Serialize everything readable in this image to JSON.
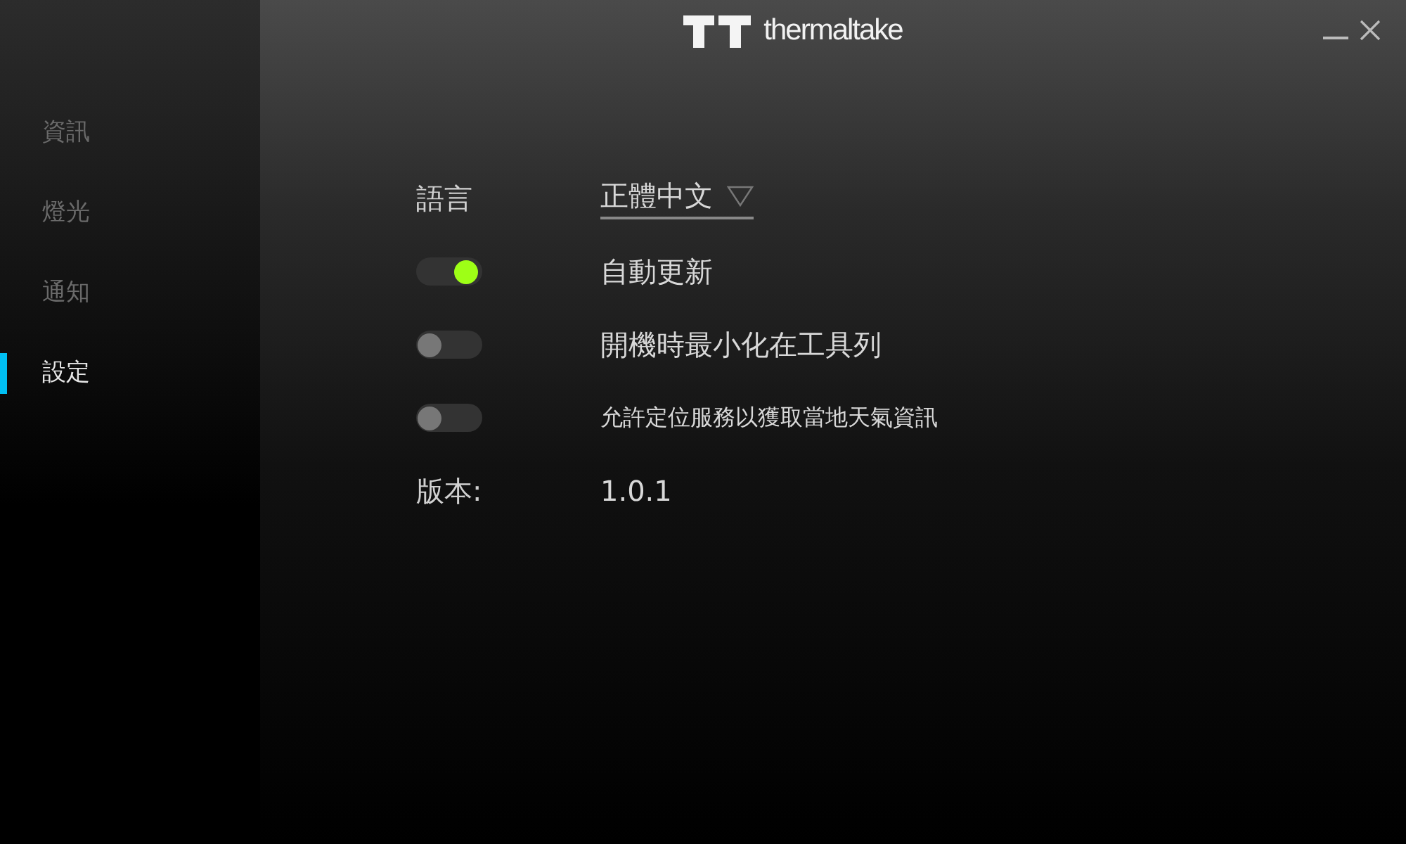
{
  "header": {
    "brand": "thermaltake"
  },
  "sidebar": {
    "items": [
      {
        "label": "資訊",
        "selected": false
      },
      {
        "label": "燈光",
        "selected": false
      },
      {
        "label": "通知",
        "selected": false
      },
      {
        "label": "設定",
        "selected": true
      }
    ]
  },
  "settings": {
    "rows": [
      {
        "kind": "dropdown",
        "label": "語言",
        "value": "正體中文"
      },
      {
        "kind": "toggle",
        "label": "自動更新",
        "on": true
      },
      {
        "kind": "toggle",
        "label": "開機時最小化在工具列",
        "on": false
      },
      {
        "kind": "toggle",
        "label": "允許定位服務以獲取當地天氣資訊",
        "on": false,
        "small": true
      },
      {
        "kind": "info",
        "label": "版本:",
        "value": "1.0.1"
      }
    ]
  }
}
